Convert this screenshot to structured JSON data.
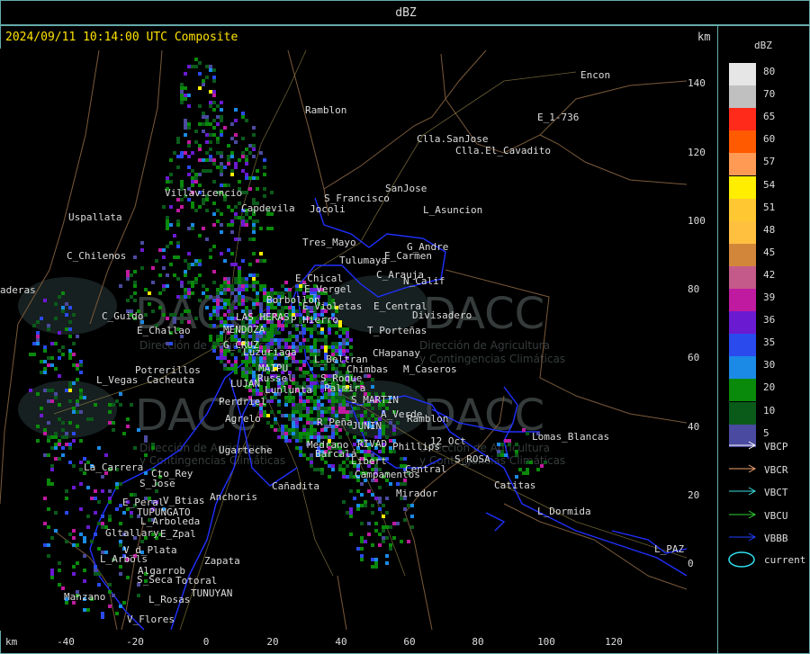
{
  "window": {
    "title": "dBZ"
  },
  "header": {
    "timestamp": "2024/09/11 10:14:00 UTC Composite",
    "km_label": "km"
  },
  "axes": {
    "x_unit": "km",
    "x_ticks": [
      "-40",
      "-20",
      "0",
      "20",
      "40",
      "60",
      "80",
      "100",
      "120"
    ],
    "y_ticks": [
      "140",
      "120",
      "100",
      "80",
      "60",
      "40",
      "20",
      "0"
    ]
  },
  "legend": {
    "title": "dBZ",
    "scale": [
      {
        "value": "80",
        "color": "#e6e6e6"
      },
      {
        "value": "70",
        "color": "#c0c0c0"
      },
      {
        "value": "65",
        "color": "#ff2a1a"
      },
      {
        "value": "60",
        "color": "#ff5a00"
      },
      {
        "value": "57",
        "color": "#ff9a55"
      },
      {
        "value": "54",
        "color": "#ffee00"
      },
      {
        "value": "51",
        "color": "#ffc832"
      },
      {
        "value": "48",
        "color": "#ffc040"
      },
      {
        "value": "45",
        "color": "#d2863a"
      },
      {
        "value": "42",
        "color": "#c45a8a"
      },
      {
        "value": "39",
        "color": "#c01aa0"
      },
      {
        "value": "36",
        "color": "#6a1ad0"
      },
      {
        "value": "35",
        "color": "#2a4aee"
      },
      {
        "value": "30",
        "color": "#1a8ae6"
      },
      {
        "value": "20",
        "color": "#0a8a0a"
      },
      {
        "value": "10",
        "color": "#0a5a1a"
      },
      {
        "value": "5",
        "color": "#4a4aa0"
      }
    ],
    "arrows": [
      {
        "label": "VBCP",
        "color": "#ffffff"
      },
      {
        "label": "VBCR",
        "color": "#f4a470"
      },
      {
        "label": "VBCT",
        "color": "#3ae0e0"
      },
      {
        "label": "VBCU",
        "color": "#30d030"
      },
      {
        "label": "VBBB",
        "color": "#2040ff"
      }
    ],
    "current": {
      "label": "current",
      "color": "#30e0f0"
    }
  },
  "places": [
    {
      "name": "Ramblon",
      "x": 339,
      "y": 126
    },
    {
      "name": "Encon",
      "x": 645,
      "y": 87
    },
    {
      "name": "E_1-736",
      "x": 597,
      "y": 134
    },
    {
      "name": "Clla.SanJose",
      "x": 463,
      "y": 158
    },
    {
      "name": "Clla.El_Cavadito",
      "x": 506,
      "y": 171
    },
    {
      "name": "SanJose",
      "x": 428,
      "y": 213
    },
    {
      "name": "Villavicencio",
      "x": 183,
      "y": 218
    },
    {
      "name": "Uspallata",
      "x": 76,
      "y": 245
    },
    {
      "name": "Capdevila",
      "x": 268,
      "y": 235
    },
    {
      "name": "S_Francisco",
      "x": 360,
      "y": 224
    },
    {
      "name": "Jocoli",
      "x": 344,
      "y": 236
    },
    {
      "name": "L_Asuncion",
      "x": 470,
      "y": 237
    },
    {
      "name": "Tres_Mayo",
      "x": 336,
      "y": 273
    },
    {
      "name": "G_Andre",
      "x": 452,
      "y": 278
    },
    {
      "name": "E_Carmen",
      "x": 427,
      "y": 288
    },
    {
      "name": "Tulumaya",
      "x": 377,
      "y": 293
    },
    {
      "name": "C_Chilenos",
      "x": 74,
      "y": 288
    },
    {
      "name": "E_Chical",
      "x": 328,
      "y": 313
    },
    {
      "name": "C_Arauja",
      "x": 418,
      "y": 309
    },
    {
      "name": "N_Calif",
      "x": 448,
      "y": 316
    },
    {
      "name": "E_Vergel",
      "x": 338,
      "y": 325
    },
    {
      "name": "Borbollon",
      "x": 296,
      "y": 337
    },
    {
      "name": "E_Violetas",
      "x": 336,
      "y": 344
    },
    {
      "name": "E_Central",
      "x": 415,
      "y": 344
    },
    {
      "name": "Divisadero",
      "x": 458,
      "y": 354
    },
    {
      "name": "P_Hierro",
      "x": 323,
      "y": 359
    },
    {
      "name": "C_Guido",
      "x": 113,
      "y": 355
    },
    {
      "name": "E_Challao",
      "x": 152,
      "y": 371
    },
    {
      "name": "MENDOZA",
      "x": 248,
      "y": 370
    },
    {
      "name": "LAS HERAS",
      "x": 262,
      "y": 356
    },
    {
      "name": "T_Porteñas",
      "x": 408,
      "y": 371
    },
    {
      "name": "G_CRUZ",
      "x": 248,
      "y": 387
    },
    {
      "name": "Luzuriaga",
      "x": 270,
      "y": 395
    },
    {
      "name": "CHapanay",
      "x": 414,
      "y": 396
    },
    {
      "name": "L_Beltran",
      "x": 349,
      "y": 403
    },
    {
      "name": "MAIPU",
      "x": 287,
      "y": 413
    },
    {
      "name": "Potrerillos",
      "x": 150,
      "y": 415
    },
    {
      "name": "Chimbas",
      "x": 385,
      "y": 414
    },
    {
      "name": "M_Caseros",
      "x": 448,
      "y": 414
    },
    {
      "name": "Russel",
      "x": 286,
      "y": 424
    },
    {
      "name": "L_Vegas",
      "x": 107,
      "y": 426
    },
    {
      "name": "Cacheuta",
      "x": 163,
      "y": 426
    },
    {
      "name": "LUJAN",
      "x": 256,
      "y": 430
    },
    {
      "name": "Lunlunta",
      "x": 294,
      "y": 437
    },
    {
      "name": "Palmira",
      "x": 360,
      "y": 435
    },
    {
      "name": "S_Roque",
      "x": 356,
      "y": 424
    },
    {
      "name": "S_MARTIN",
      "x": 390,
      "y": 448
    },
    {
      "name": "Perdriel",
      "x": 243,
      "y": 450
    },
    {
      "name": "A_Verde",
      "x": 423,
      "y": 464
    },
    {
      "name": "Ramblon",
      "x": 452,
      "y": 469
    },
    {
      "name": "Agrelo",
      "x": 250,
      "y": 469
    },
    {
      "name": "R_Peña",
      "x": 352,
      "y": 473
    },
    {
      "name": "JUNIN",
      "x": 391,
      "y": 477
    },
    {
      "name": "RIVAD",
      "x": 397,
      "y": 497
    },
    {
      "name": "Phillips",
      "x": 436,
      "y": 500
    },
    {
      "name": "12_Oct",
      "x": 478,
      "y": 494
    },
    {
      "name": "Lomas_Blancas",
      "x": 591,
      "y": 489
    },
    {
      "name": "Medrano",
      "x": 341,
      "y": 498
    },
    {
      "name": "Ugarteche",
      "x": 243,
      "y": 504
    },
    {
      "name": "Barcalá",
      "x": 350,
      "y": 508
    },
    {
      "name": "S_ROSA",
      "x": 505,
      "y": 514
    },
    {
      "name": "Libert",
      "x": 390,
      "y": 516
    },
    {
      "name": "Central",
      "x": 450,
      "y": 525
    },
    {
      "name": "La_Carrera",
      "x": 93,
      "y": 523
    },
    {
      "name": "Campamentos",
      "x": 394,
      "y": 531
    },
    {
      "name": "Cto_Rey",
      "x": 168,
      "y": 530
    },
    {
      "name": "S_Jose",
      "x": 155,
      "y": 541
    },
    {
      "name": "Cañadita",
      "x": 302,
      "y": 544
    },
    {
      "name": "Catitas",
      "x": 549,
      "y": 543
    },
    {
      "name": "Mirador",
      "x": 440,
      "y": 552
    },
    {
      "name": "Anchoris",
      "x": 233,
      "y": 556
    },
    {
      "name": "E_Peral",
      "x": 136,
      "y": 562
    },
    {
      "name": "V_Btias",
      "x": 181,
      "y": 560
    },
    {
      "name": "TUPUNGATO",
      "x": 152,
      "y": 573
    },
    {
      "name": "L_Dormida",
      "x": 597,
      "y": 572
    },
    {
      "name": "L_Arboleda",
      "x": 156,
      "y": 583
    },
    {
      "name": "Gltallary",
      "x": 117,
      "y": 596
    },
    {
      "name": "E_Zpal",
      "x": 178,
      "y": 597
    },
    {
      "name": "V_d_Plata",
      "x": 137,
      "y": 615
    },
    {
      "name": "L_PAZ",
      "x": 727,
      "y": 614
    },
    {
      "name": "L_Arbols",
      "x": 111,
      "y": 625
    },
    {
      "name": "Zapata",
      "x": 227,
      "y": 627
    },
    {
      "name": "Algarrob",
      "x": 153,
      "y": 638
    },
    {
      "name": "S_Seca",
      "x": 152,
      "y": 648
    },
    {
      "name": "Totoral",
      "x": 195,
      "y": 649
    },
    {
      "name": "TUNUYAN",
      "x": 212,
      "y": 663
    },
    {
      "name": "Manzano",
      "x": 71,
      "y": 667
    },
    {
      "name": "L_Rosas",
      "x": 165,
      "y": 670
    },
    {
      "name": "V_Flores",
      "x": 141,
      "y": 692
    },
    {
      "name": "aderas",
      "x": 0,
      "y": 326
    }
  ],
  "watermark": {
    "name": "DACC",
    "line1": "Dirección de Agricultura",
    "line2": "y Contingencias Climáticas"
  }
}
